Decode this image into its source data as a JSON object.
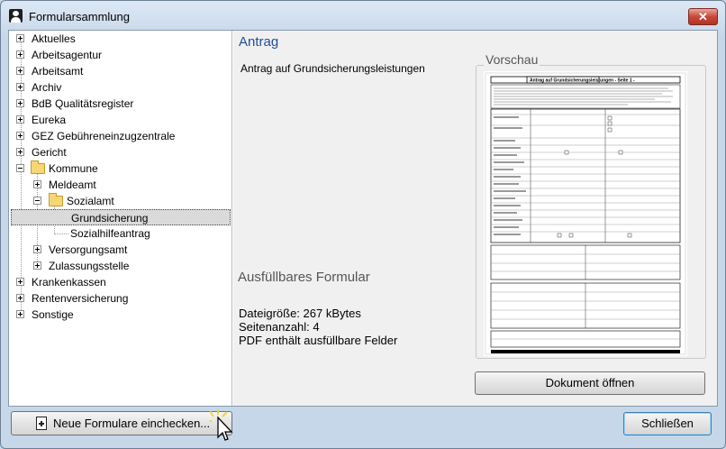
{
  "window": {
    "title": "Formularsammlung",
    "close_label": "✕"
  },
  "tree": {
    "items": [
      {
        "label": "Aktuelles"
      },
      {
        "label": "Arbeitsagentur"
      },
      {
        "label": "Arbeitsamt"
      },
      {
        "label": "Archiv"
      },
      {
        "label": "BdB Qualitätsregister"
      },
      {
        "label": "Eureka"
      },
      {
        "label": "GEZ Gebühreneinzugzentrale"
      },
      {
        "label": "Gericht"
      },
      {
        "label": "Kommune"
      },
      {
        "label": "Meldeamt"
      },
      {
        "label": "Sozialamt"
      },
      {
        "label": "Grundsicherung"
      },
      {
        "label": "Sozialhilfeantrag"
      },
      {
        "label": "Versorgungsamt"
      },
      {
        "label": "Zulassungsstelle"
      },
      {
        "label": "Krankenkassen"
      },
      {
        "label": "Rentenversicherung"
      },
      {
        "label": "Sonstige"
      }
    ]
  },
  "detail": {
    "heading": "Antrag",
    "subtitle": "Antrag auf Grundsicherungsleistungen",
    "section_heading": "Ausfüllbares Formular",
    "info": [
      "Dateigröße: 267 kBytes",
      "Seitenanzahl: 4",
      "PDF enthält ausfüllbare Felder"
    ]
  },
  "preview": {
    "label": "Vorschau",
    "document_title": "Antrag auf Grundsicherungsleistungen - Seite 1 -"
  },
  "buttons": {
    "open_document": "Dokument öffnen",
    "check_in": "Neue Formulare einchecken...",
    "close": "Schließen"
  },
  "icons": {
    "window": "user-icon",
    "check_in": "document-plus-icon",
    "folder": "folder-icon",
    "cursor": "mouse-pointer-icon"
  }
}
